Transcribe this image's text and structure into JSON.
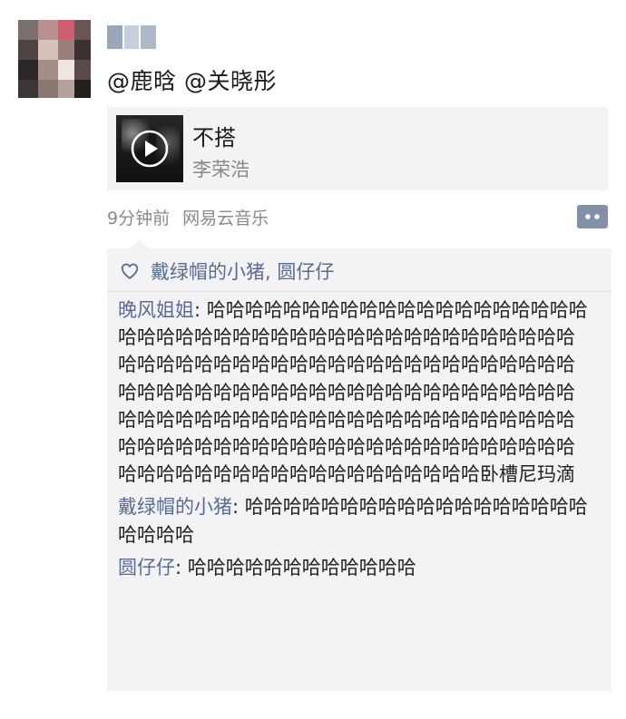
{
  "post": {
    "nickname": "",
    "text": "@鹿晗 @关晓彤"
  },
  "music_card": {
    "title": "不搭",
    "artist": "李荣浩",
    "play_icon": "play-circle-icon"
  },
  "meta": {
    "time": "9分钟前",
    "source": "网易云音乐",
    "comment_icon": "comment-bubble-icon"
  },
  "likes": {
    "icon": "heart-outline-icon",
    "names": "戴绿帽的小猪, 圆仔仔"
  },
  "comments": [
    {
      "author": "晚风姐姐",
      "separator": ": ",
      "text": "哈哈哈哈哈哈哈哈哈哈哈哈哈哈哈哈哈哈哈哈哈哈哈哈哈哈哈哈哈哈哈哈哈哈哈哈哈哈哈哈哈哈哈哈哈哈哈哈哈哈哈哈哈哈哈哈哈哈哈哈哈哈哈哈哈哈哈哈哈哈哈哈哈哈哈哈哈哈哈哈哈哈哈哈哈哈哈哈哈哈哈哈哈哈哈哈哈哈哈哈哈哈哈哈哈哈哈哈哈哈哈哈哈哈哈哈哈哈哈哈哈哈哈哈哈哈哈哈哈哈哈哈哈哈哈哈哈哈哈哈哈哈哈哈哈哈哈哈哈哈哈哈哈哈哈哈哈哈哈卧槽尼玛滴"
    },
    {
      "author": "戴绿帽的小猪",
      "separator": ": ",
      "text": "哈哈哈哈哈哈哈哈哈哈哈哈哈哈哈哈哈哈哈哈哈哈"
    },
    {
      "author": "圆仔仔",
      "separator": ": ",
      "text": "哈哈哈哈哈哈哈哈哈哈哈哈"
    }
  ],
  "colors": {
    "link": "#576b95",
    "card_bg": "#f3f3f5",
    "meta_text": "#8a8a8a"
  }
}
